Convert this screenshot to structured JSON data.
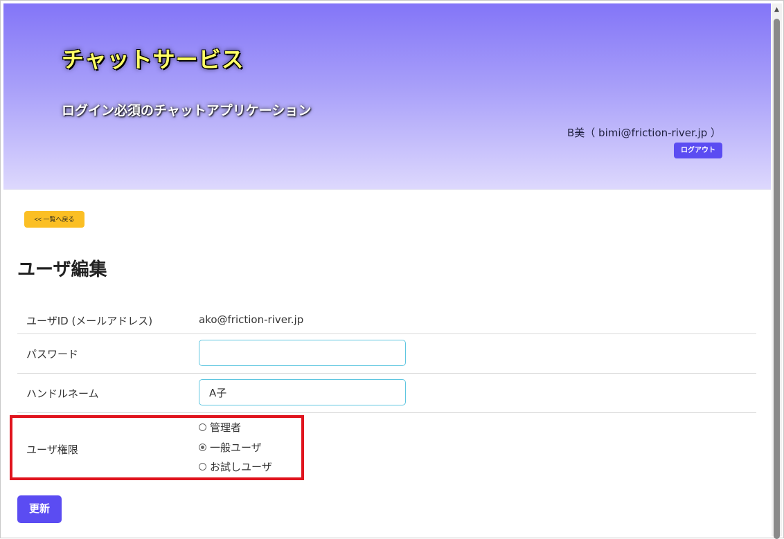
{
  "header": {
    "app_title": "チャットサービス",
    "app_subtitle": "ログイン必須のチャットアプリケーション",
    "user_info": "B美（ bimi@friction-river.jp ）",
    "logout_label": "ログアウト"
  },
  "main": {
    "back_label": "<< 一覧へ戻る",
    "page_title": "ユーザ編集",
    "rows": {
      "user_id": {
        "label": "ユーザID (メールアドレス)",
        "value": "ako@friction-river.jp"
      },
      "password": {
        "label": "パスワード",
        "value": ""
      },
      "handle": {
        "label": "ハンドルネーム",
        "value": "A子"
      },
      "role": {
        "label": "ユーザ権限",
        "options": [
          {
            "label": "管理者",
            "checked": false
          },
          {
            "label": "一般ユーザ",
            "checked": true
          },
          {
            "label": "お試しユーザ",
            "checked": false
          }
        ]
      }
    },
    "update_label": "更新"
  },
  "colors": {
    "header_gradient_top": "#8375f8",
    "header_gradient_bottom": "#ddd8fd",
    "primary_button": "#5b4cf2",
    "back_button": "#fbbf24",
    "input_border": "#5ec6e0",
    "highlight_border": "#e0141e",
    "title_yellow": "#ffff66"
  },
  "icons": {
    "scroll_up": "triangle-up-icon"
  }
}
